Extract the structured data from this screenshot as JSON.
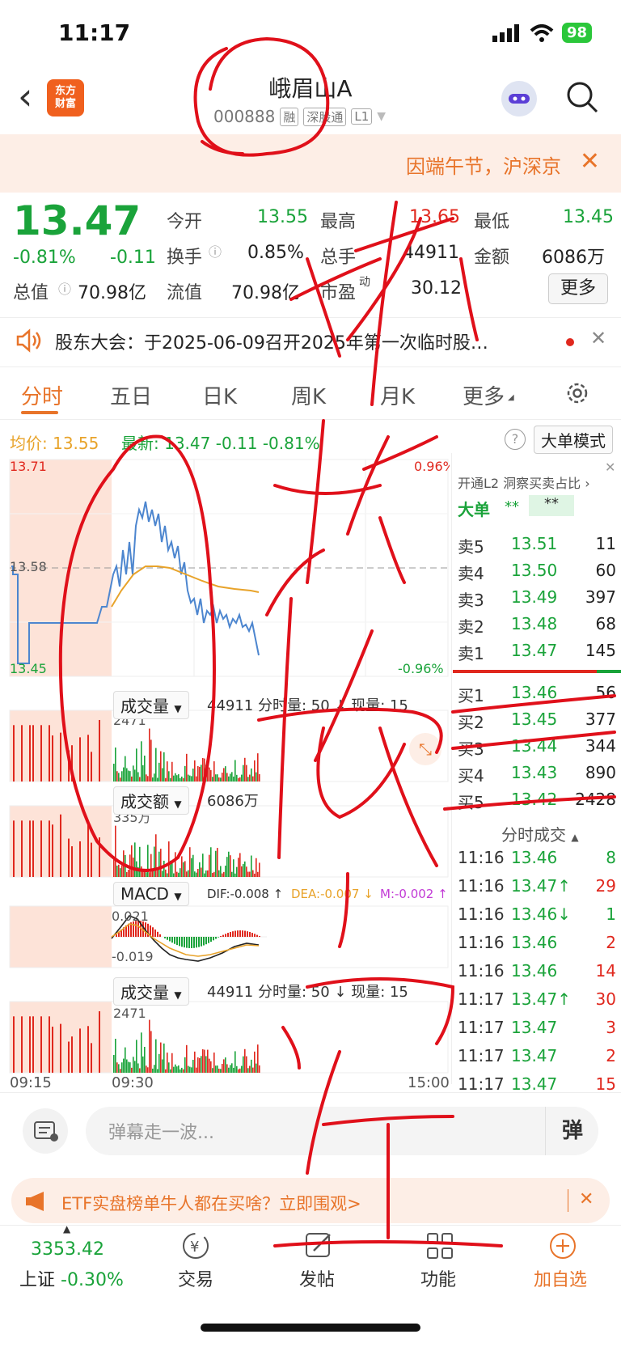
{
  "status": {
    "time": "11:17",
    "battery": "98"
  },
  "header": {
    "title": "峨眉山A",
    "code": "000888",
    "tags": [
      "融",
      "深股通",
      "L1"
    ],
    "logo_line1": "东方",
    "logo_line2": "财富"
  },
  "banner": {
    "text": "因端午节，沪深京",
    "close": "✕"
  },
  "quote": {
    "price": "13.47",
    "pct": "-0.81%",
    "chg": "-0.11",
    "open_label": "今开",
    "open": "13.55",
    "high_label": "最高",
    "high": "13.65",
    "low_label": "最低",
    "low": "13.45",
    "turnover_label": "换手",
    "turnover": "0.85%",
    "volume_label": "总手",
    "volume": "44911",
    "amount_label": "金额",
    "amount": "6086万",
    "mcap_label": "总值",
    "mcap": "70.98亿",
    "float_label": "流值",
    "float": "70.98亿",
    "pe_label": "市盈",
    "pe_sup": "动",
    "pe": "30.12",
    "more": "更多"
  },
  "notice": {
    "text": "股东大会：于2025-06-09召开2025年第一次临时股…",
    "close": "✕"
  },
  "tabs": [
    "分时",
    "五日",
    "日K",
    "周K",
    "月K",
    "更多"
  ],
  "chart": {
    "avg_label": "均价:",
    "avg": "13.55",
    "latest_label": "最新:",
    "latest": "13.47",
    "latest_chg": "-0.11",
    "latest_pct": "-0.81%",
    "mode_btn": "大单模式",
    "y_top": "13.71",
    "y_mid": "13.58",
    "y_bot": "13.45",
    "pct_top": "0.96%",
    "pct_bot": "-0.96%",
    "vol_sel": "成交量",
    "vol_info": "44911 分时量: 50 ↓ 现量: 15",
    "vol_max": "2471",
    "amt_sel": "成交额",
    "amt_info": "6086万",
    "amt_max": "335万",
    "macd_sel": "MACD",
    "dif": "DIF:-0.008 ↑",
    "dea": "DEA:-0.007 ↓",
    "m": "M:-0.002 ↑",
    "macd_top": "0.021",
    "macd_bot": "-0.019",
    "vol2_sel": "成交量",
    "vol2_info": "44911 分时量: 50 ↓ 现量: 15",
    "vol2_max": "2471",
    "t_start": "09:15",
    "t_open": "09:30",
    "t_end": "15:00"
  },
  "order_book": {
    "l2_text": "开通L2 洞察买卖占比 ›",
    "big_label": "大单",
    "big_val1": "**",
    "big_val2": "**",
    "asks": [
      {
        "label": "卖5",
        "price": "13.51",
        "vol": "11"
      },
      {
        "label": "卖4",
        "price": "13.50",
        "vol": "60"
      },
      {
        "label": "卖3",
        "price": "13.49",
        "vol": "397"
      },
      {
        "label": "卖2",
        "price": "13.48",
        "vol": "68"
      },
      {
        "label": "卖1",
        "price": "13.47",
        "vol": "145"
      }
    ],
    "bids": [
      {
        "label": "买1",
        "price": "13.46",
        "vol": "56"
      },
      {
        "label": "买2",
        "price": "13.45",
        "vol": "377"
      },
      {
        "label": "买3",
        "price": "13.44",
        "vol": "344"
      },
      {
        "label": "买4",
        "price": "13.43",
        "vol": "890"
      },
      {
        "label": "买5",
        "price": "13.42",
        "vol": "2428"
      }
    ],
    "ticks_title": "分时成交",
    "ticks": [
      {
        "t": "11:16",
        "p": "13.46",
        "v": "8"
      },
      {
        "t": "11:16",
        "p": "13.47↑",
        "v": "29"
      },
      {
        "t": "11:16",
        "p": "13.46↓",
        "v": "1"
      },
      {
        "t": "11:16",
        "p": "13.46",
        "v": "2"
      },
      {
        "t": "11:16",
        "p": "13.46",
        "v": "14"
      },
      {
        "t": "11:17",
        "p": "13.47↑",
        "v": "30"
      },
      {
        "t": "11:17",
        "p": "13.47",
        "v": "3"
      },
      {
        "t": "11:17",
        "p": "13.47",
        "v": "2"
      },
      {
        "t": "11:17",
        "p": "13.47",
        "v": "15"
      }
    ]
  },
  "danmu": {
    "placeholder": "弹幕走一波...",
    "btn": "弹"
  },
  "ad": {
    "text": "ETF实盘榜单牛人都在买啥？立即围观>",
    "close": "✕"
  },
  "bottom": {
    "index_val": "3353.42",
    "index_name": "上证",
    "index_pct": "-0.30%",
    "trade": "交易",
    "post": "发帖",
    "func": "功能",
    "add": "加自选"
  }
}
